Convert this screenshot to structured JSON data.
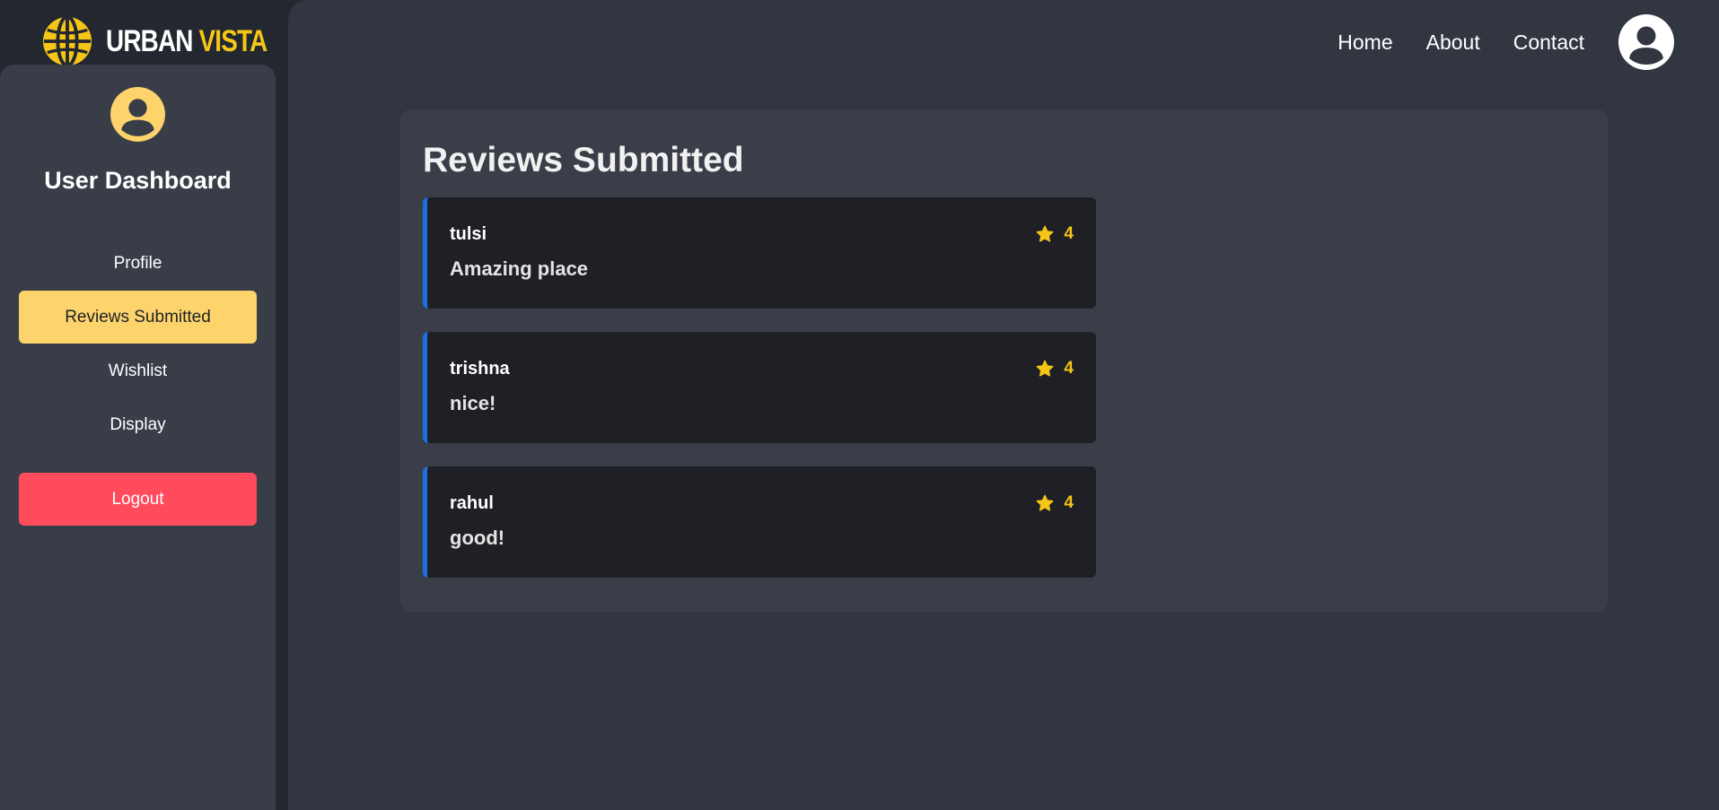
{
  "brand": {
    "word1": "URBAN",
    "word2": "VISTA",
    "accent_color": "#f5c518"
  },
  "sidebar": {
    "title": "User Dashboard",
    "items": [
      {
        "label": "Profile",
        "active": false
      },
      {
        "label": "Reviews Submitted",
        "active": true
      },
      {
        "label": "Wishlist",
        "active": false
      },
      {
        "label": "Display",
        "active": false
      }
    ],
    "logout_label": "Logout",
    "active_color": "#fdd46b",
    "logout_color": "#ff4b5c"
  },
  "topnav": {
    "links": [
      "Home",
      "About",
      "Contact"
    ],
    "avatar_icon": "user-avatar-icon"
  },
  "main": {
    "title": "Reviews Submitted",
    "reviews": [
      {
        "user": "tulsi",
        "text": "Amazing place",
        "rating": "4"
      },
      {
        "user": "trishna",
        "text": "nice!",
        "rating": "4"
      },
      {
        "user": "rahul",
        "text": "good!",
        "rating": "4"
      }
    ],
    "review_accent": "#1e6fe0",
    "star_icon": "star-icon"
  }
}
